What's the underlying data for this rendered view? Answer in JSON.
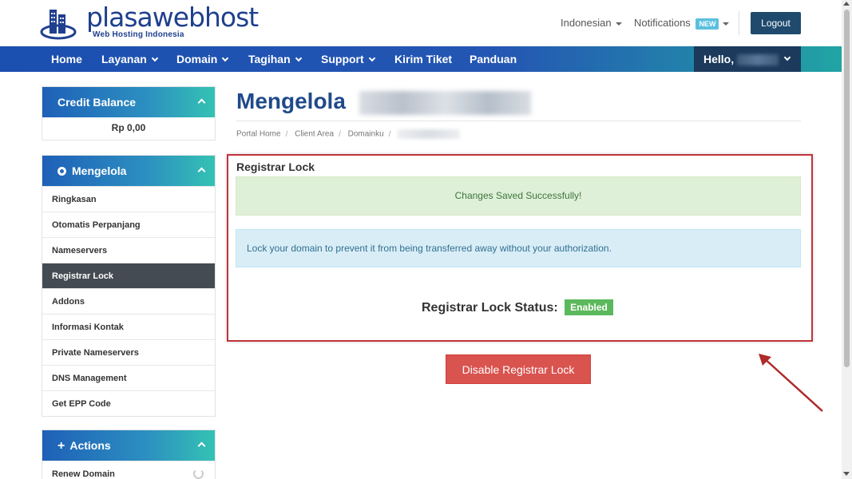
{
  "brand": {
    "name": "plasawebhost",
    "tagline": "Web Hosting Indonesia",
    "primary_color": "#1f3f8f"
  },
  "header": {
    "language": "Indonesian",
    "notifications_label": "Notifications",
    "notifications_badge": "NEW",
    "logout_label": "Logout"
  },
  "nav": {
    "items": [
      {
        "label": "Home"
      },
      {
        "label": "Layanan"
      },
      {
        "label": "Domain"
      },
      {
        "label": "Tagihan"
      },
      {
        "label": "Support"
      },
      {
        "label": "Kirim Tiket"
      },
      {
        "label": "Panduan"
      }
    ],
    "hello_label": "Hello,"
  },
  "sidebar": {
    "credit": {
      "title": "Credit Balance",
      "amount": "Rp 0,00"
    },
    "manage": {
      "title": "Mengelola",
      "items": [
        {
          "label": "Ringkasan"
        },
        {
          "label": "Otomatis Perpanjang"
        },
        {
          "label": "Nameservers"
        },
        {
          "label": "Registrar Lock",
          "active": true
        },
        {
          "label": "Addons"
        },
        {
          "label": "Informasi Kontak"
        },
        {
          "label": "Private Nameservers"
        },
        {
          "label": "DNS Management"
        },
        {
          "label": "Get EPP Code"
        }
      ]
    },
    "actions": {
      "title": "Actions",
      "items": [
        {
          "label": "Renew Domain"
        }
      ]
    }
  },
  "main": {
    "title": "Mengelola",
    "breadcrumb": [
      "Portal Home",
      "Client Area",
      "Domainku"
    ],
    "section_title": "Registrar Lock",
    "success_message": "Changes Saved Successfully!",
    "info_message": "Lock your domain to prevent it from being transferred away without your authorization.",
    "status_label": "Registrar Lock Status:",
    "status_value": "Enabled",
    "disable_button": "Disable Registrar Lock"
  },
  "colors": {
    "nav_start": "#1b4fb0",
    "nav_end": "#21a4a4",
    "success_bg": "#dff0d8",
    "info_bg": "#d9edf7",
    "danger": "#d9534f",
    "enabled_badge": "#5cb85c",
    "highlight_box": "#c0343a"
  }
}
